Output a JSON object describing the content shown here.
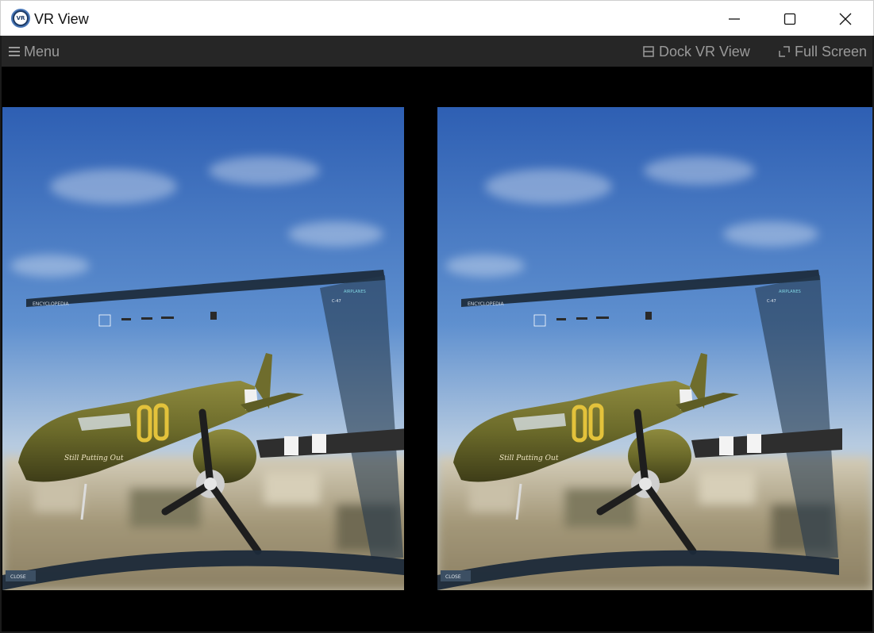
{
  "window": {
    "title": "VR View",
    "logo_text": "VR"
  },
  "toolbar": {
    "menu_label": "Menu",
    "dock_label": "Dock VR View",
    "fullscreen_label": "Full Screen"
  },
  "scene": {
    "panel_title": "ENCYCLOPEDIA",
    "side_tab": "AIRPLANES",
    "side_item": "C-47",
    "close_label": "CLOSE",
    "fuselage_code": "OO",
    "nose_art": "Still Putting Out",
    "colors": {
      "sky_top": "#2f62b5",
      "sky_bottom": "#b9cce0",
      "olive": "#6b6a2a",
      "panel_frame": "#1c2a3a"
    }
  },
  "icons": [
    "vr-logo-icon",
    "minimize-icon",
    "maximize-icon",
    "close-icon",
    "menu-icon",
    "dock-icon",
    "fullscreen-icon"
  ]
}
